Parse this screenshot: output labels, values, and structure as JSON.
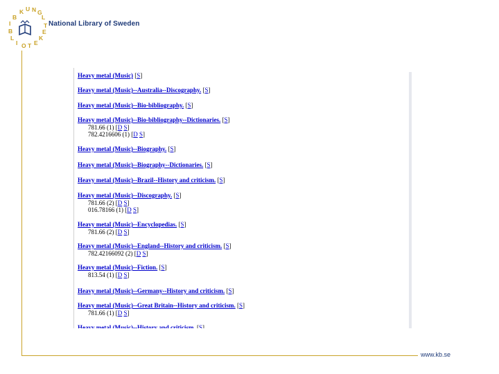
{
  "header": {
    "brand": "National Library of Sweden",
    "seal_text": "KUNGL BIBLIOTEKET"
  },
  "footer": {
    "site": "www.kb.se"
  },
  "catalog": {
    "entries": [
      {
        "heading": "Heavy metal (Music)",
        "tag": "S",
        "calls": []
      },
      {
        "heading": "Heavy metal (Music)--Australia--Discography.",
        "tag": "S",
        "calls": []
      },
      {
        "heading": "Heavy metal (Music)--Bio-bibliography.",
        "tag": "S",
        "calls": []
      },
      {
        "heading": "Heavy metal (Music)--Bio-bibliography--Dictionaries.",
        "tag": "S",
        "calls": [
          {
            "num": "781.66 (1)",
            "d": "D",
            "s": "S"
          },
          {
            "num": "782.4216606 (1)",
            "d": "D",
            "s": "S"
          }
        ]
      },
      {
        "heading": "Heavy metal (Music)--Biography.",
        "tag": "S",
        "calls": []
      },
      {
        "heading": "Heavy metal (Music)--Biography--Dictionaries.",
        "tag": "S",
        "calls": []
      },
      {
        "heading": "Heavy metal (Music)--Brazil--History and criticism.",
        "tag": "S",
        "calls": []
      },
      {
        "heading": "Heavy metal (Music)--Discography.",
        "tag": "S",
        "calls": [
          {
            "num": "781.66 (2)",
            "d": "D",
            "s": "S"
          },
          {
            "num": "016.78166 (1)",
            "d": "D",
            "s": "S"
          }
        ]
      },
      {
        "heading": "Heavy metal (Music)--Encyclopedias.",
        "tag": "S",
        "calls": [
          {
            "num": "781.66 (2)",
            "d": "D",
            "s": "S"
          }
        ]
      },
      {
        "heading": "Heavy metal (Music)--England--History and criticism.",
        "tag": "S",
        "calls": [
          {
            "num": "782.42166092 (2)",
            "d": "D",
            "s": "S"
          }
        ]
      },
      {
        "heading": "Heavy metal (Music)--Fiction.",
        "tag": "S",
        "calls": [
          {
            "num": "813.54 (1)",
            "d": "D",
            "s": "S"
          }
        ]
      },
      {
        "heading": "Heavy metal (Music)--Germany--History and criticism.",
        "tag": "S",
        "calls": []
      },
      {
        "heading": "Heavy metal (Music)--Great Britain--History and criticism.",
        "tag": "S",
        "calls": [
          {
            "num": "781.66 (1)",
            "d": "D",
            "s": "S"
          }
        ]
      },
      {
        "heading": "Heavy metal (Music)--History and criticism.",
        "tag": "S",
        "calls": []
      }
    ]
  }
}
